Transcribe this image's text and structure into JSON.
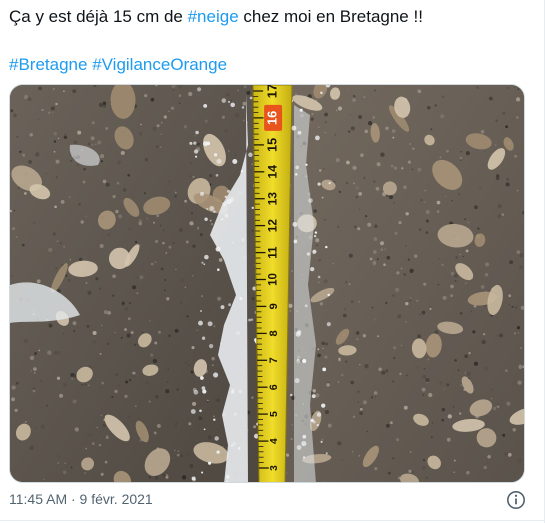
{
  "tweet": {
    "text_before": "Ça y est déjà 15 cm de ",
    "hashtag_inline": "#neige",
    "text_after": " chez moi en Bretagne !!",
    "hashtag_1": "#Bretagne",
    "hashtag_2": "#VigilanceOrange",
    "timestamp": "11:45 AM · 9 févr. 2021"
  },
  "media": {
    "ruler_numbers": [
      "3",
      "4",
      "5",
      "6",
      "7",
      "8",
      "9",
      "10",
      "11",
      "12",
      "13",
      "14",
      "15",
      "16",
      "17"
    ],
    "highlighted_number": "16"
  },
  "icons": {
    "info": "info-circle-icon"
  },
  "colors": {
    "hashtag": "#1d9bf0",
    "meta": "#536471",
    "ruler": "#e6d21c",
    "ruler_highlight": "#e8541c"
  }
}
